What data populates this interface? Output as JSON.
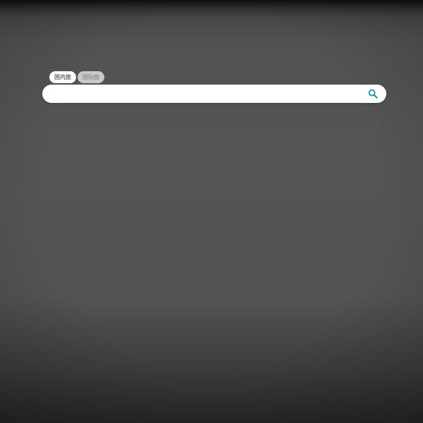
{
  "search": {
    "tabs": [
      {
        "label": "国内旅",
        "active": true
      },
      {
        "label": "国际旅",
        "active": false
      }
    ],
    "input_value": "",
    "placeholder": "",
    "icon": "search-icon",
    "accent_color": "#1a8fb3"
  },
  "colors": {
    "background": "#555555",
    "tab_active_bg": "#ffffff",
    "tab_inactive_bg": "#c9c9c9"
  }
}
